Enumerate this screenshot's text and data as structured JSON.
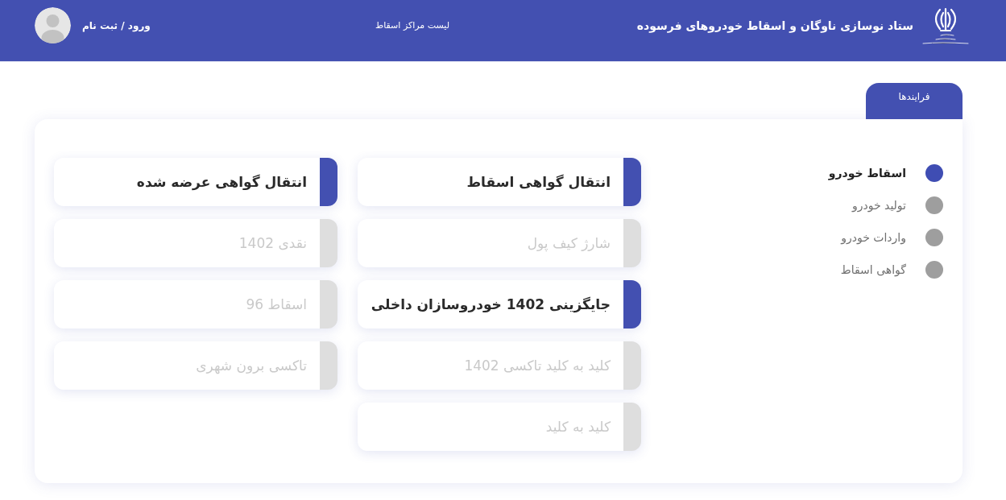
{
  "header": {
    "title": "ستاد نوسازی ناوگان و اسقاط خودروهای فرسوده",
    "nav_link": "لیست مراکز اسقاط",
    "login": "ورود / ثبت نام"
  },
  "tabs": [
    {
      "label": "فرایندها",
      "selected": true
    }
  ],
  "processes": [
    {
      "label": "اسقاط خودرو",
      "selected": true
    },
    {
      "label": "تولید خودرو",
      "selected": false
    },
    {
      "label": "واردات خودرو",
      "selected": false
    },
    {
      "label": "گواهی اسقاط",
      "selected": false
    }
  ],
  "cards": [
    {
      "label": "انتقال گواهی اسقاط",
      "disabled": false
    },
    {
      "label": "انتقال گواهی عرضه شده",
      "disabled": false
    },
    {
      "label": "شارژ کیف پول",
      "disabled": true
    },
    {
      "label": "نقدی 1402",
      "disabled": true
    },
    {
      "label": "جایگزینی 1402 خودروسازان داخلی",
      "disabled": false
    },
    {
      "label": "اسقاط 96",
      "disabled": true
    },
    {
      "label": "کلید به کلید تاکسی 1402",
      "disabled": true
    },
    {
      "label": "تاکسی برون شهری",
      "disabled": true
    },
    {
      "label": "کلید به کلید",
      "disabled": true
    }
  ]
}
